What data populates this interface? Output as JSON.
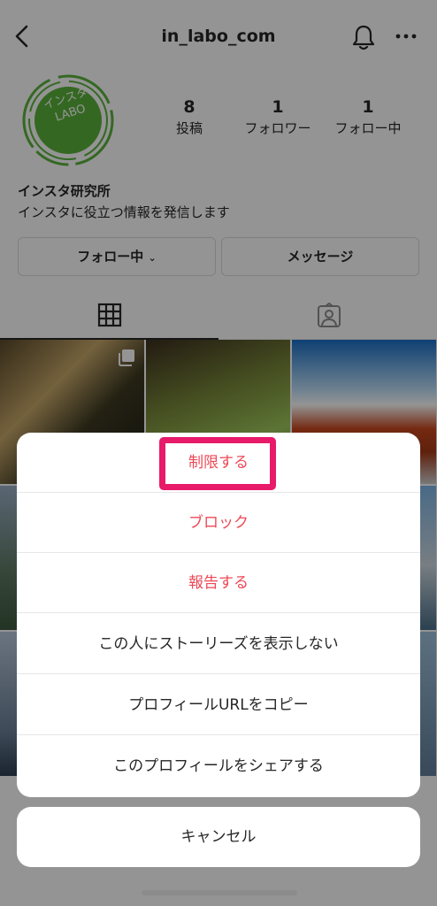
{
  "header": {
    "username": "in_labo_com"
  },
  "profile": {
    "avatar_text": "インスタ\nLABO",
    "stats": {
      "posts": {
        "value": "8",
        "label": "投稿"
      },
      "followers": {
        "value": "1",
        "label": "フォロワー"
      },
      "following": {
        "value": "1",
        "label": "フォロー中"
      }
    },
    "name": "インスタ研究所",
    "bio": "インスタに役立つ情報を発信します",
    "following_button": "フォロー中",
    "message_button": "メッセージ"
  },
  "icons": {
    "back": "chevron-left-icon",
    "notifications": "bell-icon",
    "more": "more-horizontal-icon",
    "grid_tab": "grid-icon",
    "tagged_tab": "tagged-person-icon",
    "multi_post": "multiple-posts-icon"
  },
  "action_sheet": {
    "items": [
      {
        "label": "制限する",
        "color": "#ed4956"
      },
      {
        "label": "ブロック",
        "color": "#ed4956"
      },
      {
        "label": "報告する",
        "color": "#ed4956"
      },
      {
        "label": "この人にストーリーズを表示しない",
        "color": "#262626"
      },
      {
        "label": "プロフィールURLをコピー",
        "color": "#262626"
      },
      {
        "label": "このプロフィールをシェアする",
        "color": "#262626"
      }
    ],
    "cancel": "キャンセル",
    "highlight_color": "#e81a6a"
  },
  "colors": {
    "destructive": "#ed4956",
    "avatar_green": "#5ab43c"
  }
}
